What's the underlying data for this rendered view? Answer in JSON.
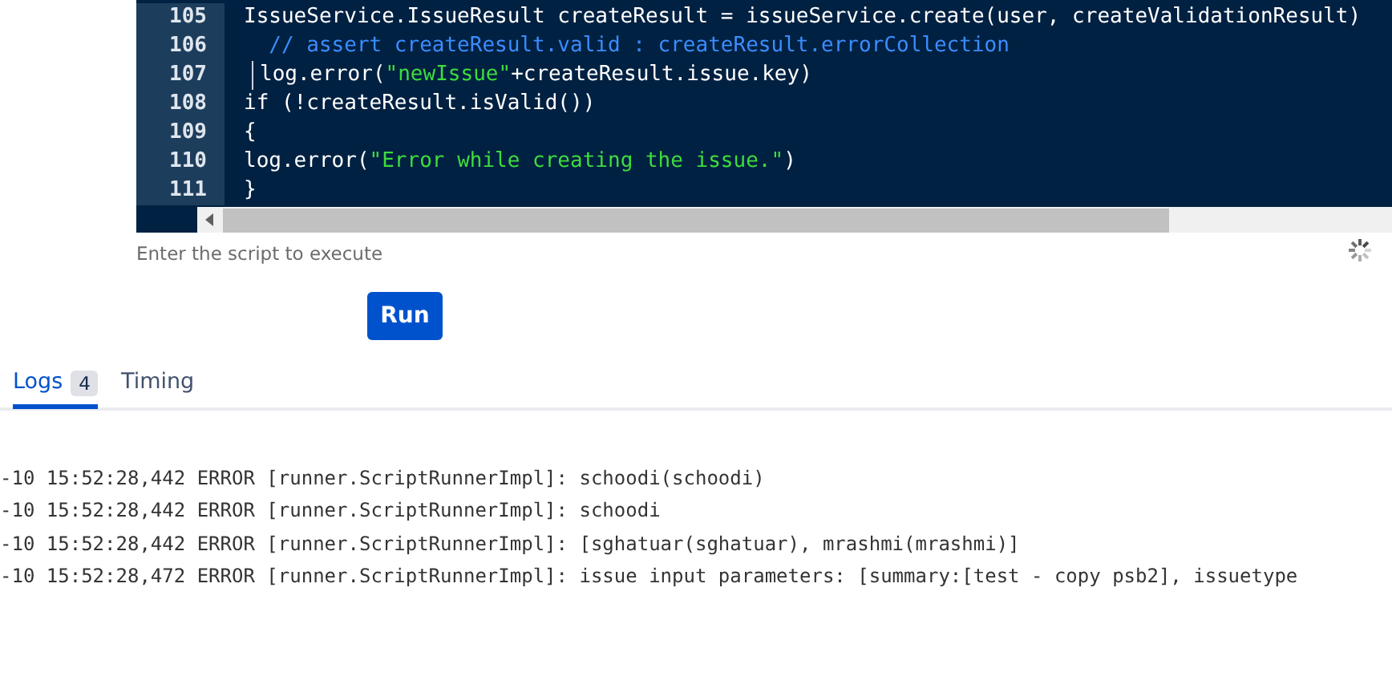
{
  "editor": {
    "lines": [
      {
        "number": "105",
        "guide": false,
        "segments": [
          {
            "kind": "plain",
            "text": "IssueService.IssueResult createResult = issueService.create(user, createValidationResult)"
          }
        ]
      },
      {
        "number": "106",
        "guide": false,
        "segments": [
          {
            "kind": "comment",
            "text": "  // assert createResult.valid : createResult.errorCollection"
          }
        ]
      },
      {
        "number": "107",
        "guide": true,
        "segments": [
          {
            "kind": "plain",
            "text": "log.error("
          },
          {
            "kind": "string",
            "text": "\"newIssue\""
          },
          {
            "kind": "plain",
            "text": "+createResult.issue.key)"
          }
        ]
      },
      {
        "number": "108",
        "guide": false,
        "segments": [
          {
            "kind": "plain",
            "text": "if (!createResult.isValid())"
          }
        ]
      },
      {
        "number": "109",
        "guide": false,
        "segments": [
          {
            "kind": "plain",
            "text": "{"
          }
        ]
      },
      {
        "number": "110",
        "guide": false,
        "segments": [
          {
            "kind": "plain",
            "text": "log.error("
          },
          {
            "kind": "string",
            "text": "\"Error while creating the issue.\""
          },
          {
            "kind": "plain",
            "text": ")"
          }
        ]
      },
      {
        "number": "111",
        "guide": false,
        "segments": [
          {
            "kind": "plain",
            "text": "}"
          }
        ]
      }
    ],
    "hint": "Enter the script to execute",
    "loading": true
  },
  "run_button": "Run",
  "tabs": [
    {
      "label": "Logs",
      "count": "4",
      "selected": true
    },
    {
      "label": "Timing",
      "selected": false
    }
  ],
  "logs": [
    "-10 15:52:28,442 ERROR [runner.ScriptRunnerImpl]: schoodi(schoodi)",
    "-10 15:52:28,442 ERROR [runner.ScriptRunnerImpl]: schoodi",
    "-10 15:52:28,442 ERROR [runner.ScriptRunnerImpl]: [sghatuar(sghatuar), mrashmi(mrashmi)]",
    "-10 15:52:28,472 ERROR [runner.ScriptRunnerImpl]: issue input parameters: [summary:[test - copy psb2], issuetype"
  ]
}
